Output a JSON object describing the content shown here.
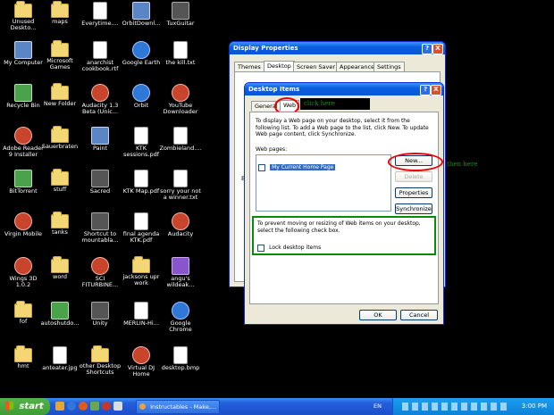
{
  "desktop_icons": [
    {
      "label": "Unused\nDeskto...",
      "kind": "folder",
      "col": 0,
      "row": 0
    },
    {
      "label": "maps",
      "kind": "folder",
      "col": 1,
      "row": 0
    },
    {
      "label": "Everytime....",
      "kind": "doc",
      "col": 2,
      "row": 0
    },
    {
      "label": "OrbitDownl...",
      "kind": "app",
      "col": 3,
      "row": 0
    },
    {
      "label": "TuxGuitar",
      "kind": "dark",
      "col": 4,
      "row": 0
    },
    {
      "label": "My Computer",
      "kind": "app",
      "col": 0,
      "row": 1
    },
    {
      "label": "Microsoft\nGames",
      "kind": "folder",
      "col": 1,
      "row": 1
    },
    {
      "label": "anarchist\ncookbook.rtf",
      "kind": "doc",
      "col": 2,
      "row": 1
    },
    {
      "label": "Google Earth",
      "kind": "globe",
      "col": 3,
      "row": 1
    },
    {
      "label": "the kill.txt",
      "kind": "doc",
      "col": 4,
      "row": 1
    },
    {
      "label": "Recycle Bin",
      "kind": "green",
      "col": 0,
      "row": 2
    },
    {
      "label": "New Folder",
      "kind": "folder",
      "col": 1,
      "row": 2
    },
    {
      "label": "Audacity 1.3\nBeta (Unic...",
      "kind": "red",
      "col": 2,
      "row": 2
    },
    {
      "label": "Orbit",
      "kind": "globe",
      "col": 3,
      "row": 2
    },
    {
      "label": "YouTube\nDownloader",
      "kind": "red",
      "col": 4,
      "row": 2
    },
    {
      "label": "Adobe Reader\n9 Installer",
      "kind": "red",
      "col": 0,
      "row": 3
    },
    {
      "label": "Sauerbraten",
      "kind": "folder",
      "col": 1,
      "row": 3
    },
    {
      "label": "Paint",
      "kind": "app",
      "col": 2,
      "row": 3
    },
    {
      "label": "KTK\nsessions.pdf",
      "kind": "doc",
      "col": 3,
      "row": 3
    },
    {
      "label": "Zombieland....",
      "kind": "doc",
      "col": 4,
      "row": 3
    },
    {
      "label": "BitTorrent",
      "kind": "green",
      "col": 0,
      "row": 4
    },
    {
      "label": "stuff",
      "kind": "folder",
      "col": 1,
      "row": 4
    },
    {
      "label": "Sacred",
      "kind": "dark",
      "col": 2,
      "row": 4
    },
    {
      "label": "KTK Map.pdf",
      "kind": "doc",
      "col": 3,
      "row": 4
    },
    {
      "label": "sorry your not\na winner.txt",
      "kind": "doc",
      "col": 4,
      "row": 4
    },
    {
      "label": "Virgin Mobile",
      "kind": "red",
      "col": 0,
      "row": 5
    },
    {
      "label": "tanks",
      "kind": "folder",
      "col": 1,
      "row": 5
    },
    {
      "label": "Shortcut to\nmountabla...",
      "kind": "dark",
      "col": 2,
      "row": 5
    },
    {
      "label": "final agenda\nKTK.pdf",
      "kind": "doc",
      "col": 3,
      "row": 5
    },
    {
      "label": "Audacity",
      "kind": "red",
      "col": 4,
      "row": 5
    },
    {
      "label": "Wings 3D\n1.0.2",
      "kind": "red",
      "col": 0,
      "row": 6
    },
    {
      "label": "word",
      "kind": "folder",
      "col": 1,
      "row": 6
    },
    {
      "label": "SCI\nFITURBINE...",
      "kind": "red",
      "col": 2,
      "row": 6
    },
    {
      "label": "jacksons upr\nwork",
      "kind": "folder",
      "col": 3,
      "row": 6
    },
    {
      "label": "angu's\nwildeak...",
      "kind": "purple",
      "col": 4,
      "row": 6
    },
    {
      "label": "fof",
      "kind": "folder",
      "col": 0,
      "row": 7
    },
    {
      "label": "autoshutdo...",
      "kind": "green",
      "col": 1,
      "row": 7
    },
    {
      "label": "Unity",
      "kind": "dark",
      "col": 2,
      "row": 7
    },
    {
      "label": "MERLIN-Hi...",
      "kind": "doc",
      "col": 3,
      "row": 7
    },
    {
      "label": "Google\nChrome",
      "kind": "globe",
      "col": 4,
      "row": 7
    },
    {
      "label": "hmt",
      "kind": "folder",
      "col": 0,
      "row": 8
    },
    {
      "label": "anteater.jpg",
      "kind": "doc",
      "col": 1,
      "row": 8
    },
    {
      "label": "other Desktop\nShortcuts",
      "kind": "folder",
      "col": 2,
      "row": 8
    },
    {
      "label": "Virtual DJ\nHome",
      "kind": "red",
      "col": 3,
      "row": 8
    },
    {
      "label": "desktop.bmp",
      "kind": "doc",
      "col": 4,
      "row": 8
    }
  ],
  "display_properties": {
    "title": "Display Properties",
    "help": "?",
    "close": "X",
    "tabs": [
      "Themes",
      "Desktop",
      "Screen Saver",
      "Appearance",
      "Settings"
    ],
    "back_btn_hint": "B"
  },
  "desktop_items": {
    "title": "Desktop Items",
    "help": "?",
    "close": "X",
    "tabs": [
      "General",
      "Web"
    ],
    "description": "To display a Web page on your desktop, select it from the following list. To add a Web page to the list, click New. To update Web page content, click Synchronize.",
    "web_pages_label": "Web pages:",
    "web_pages": [
      "My Current Home Page"
    ],
    "buttons": {
      "new": "New...",
      "delete": "Delete",
      "properties": "Properties",
      "synchronize": "Synchronize"
    },
    "lock_text": "To prevent moving or resizing of Web items on your desktop, select the following check box.",
    "lock_checkbox": "Lock desktop items",
    "ok": "OK",
    "cancel": "Cancel"
  },
  "annotations": {
    "web_tab_note": "click here",
    "new_btn_note": "then here"
  },
  "taskbar": {
    "start": "start",
    "active_task": "Instructables - Make,...",
    "language": "EN",
    "clock": "3:00 PM"
  }
}
